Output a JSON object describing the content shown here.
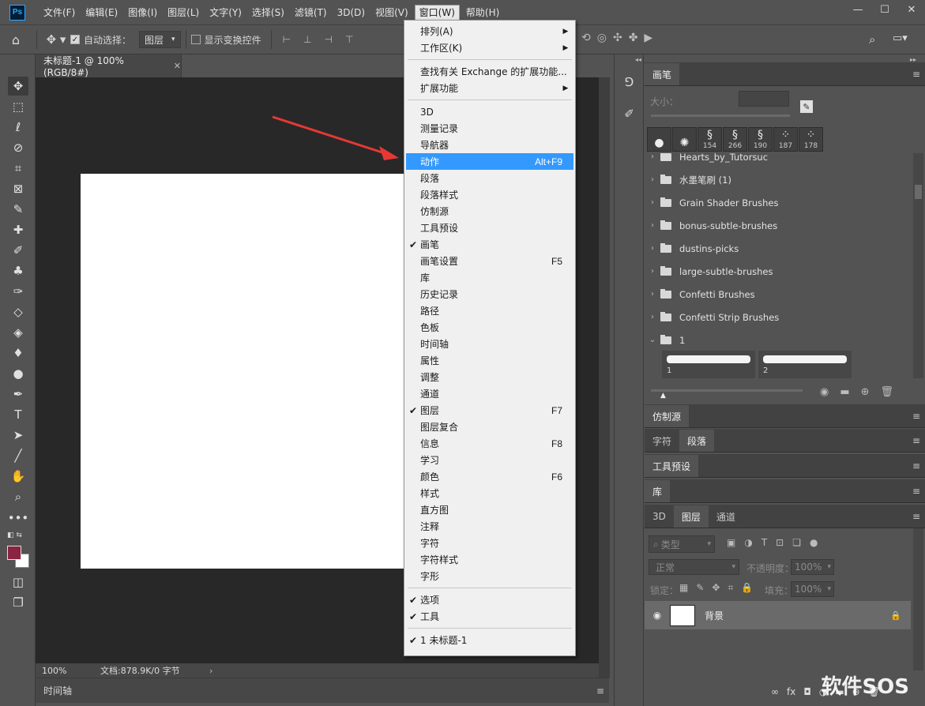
{
  "app": {
    "logo": "Ps"
  },
  "menubar": [
    "文件(F)",
    "编辑(E)",
    "图像(I)",
    "图层(L)",
    "文字(Y)",
    "选择(S)",
    "滤镜(T)",
    "3D(D)",
    "视图(V)",
    "窗口(W)",
    "帮助(H)"
  ],
  "options": {
    "auto_select": "自动选择：",
    "layer_dropdown": "图层",
    "show_transform": "显示变换控件"
  },
  "document": {
    "tab_title": "未标题-1 @ 100%(RGB/8#)",
    "zoom": "100%",
    "doc_info": "文档:878.9K/0 字节"
  },
  "timeline": {
    "label": "时间轴"
  },
  "colors": {
    "foreground": "#8b2342",
    "background": "#ffffff",
    "highlight": "#3399ff",
    "arrow": "#e53935"
  },
  "window_menu": {
    "items": [
      {
        "label": "排列(A)",
        "submenu": true
      },
      {
        "label": "工作区(K)",
        "submenu": true
      },
      {
        "sep": true
      },
      {
        "label": "查找有关 Exchange 的扩展功能..."
      },
      {
        "label": "扩展功能",
        "submenu": true
      },
      {
        "sep": true
      },
      {
        "label": "3D"
      },
      {
        "label": "测量记录"
      },
      {
        "label": "导航器"
      },
      {
        "label": "动作",
        "shortcut": "Alt+F9",
        "highlight": true
      },
      {
        "label": "段落"
      },
      {
        "label": "段落样式"
      },
      {
        "label": "仿制源"
      },
      {
        "label": "工具预设"
      },
      {
        "label": "画笔",
        "checked": true
      },
      {
        "label": "画笔设置",
        "shortcut": "F5"
      },
      {
        "label": "库"
      },
      {
        "label": "历史记录"
      },
      {
        "label": "路径"
      },
      {
        "label": "色板"
      },
      {
        "label": "时间轴"
      },
      {
        "label": "属性"
      },
      {
        "label": "调整"
      },
      {
        "label": "通道"
      },
      {
        "label": "图层",
        "shortcut": "F7",
        "checked": true
      },
      {
        "label": "图层复合"
      },
      {
        "label": "信息",
        "shortcut": "F8"
      },
      {
        "label": "学习"
      },
      {
        "label": "颜色",
        "shortcut": "F6"
      },
      {
        "label": "样式"
      },
      {
        "label": "直方图"
      },
      {
        "label": "注释"
      },
      {
        "label": "字符"
      },
      {
        "label": "字符样式"
      },
      {
        "label": "字形"
      },
      {
        "sep": true
      },
      {
        "label": "选项",
        "checked": true
      },
      {
        "label": "工具",
        "checked": true
      },
      {
        "sep": true
      },
      {
        "label": "1 未标题-1",
        "checked": true
      }
    ]
  },
  "brush_panel": {
    "tab": "画笔",
    "size_label": "大小：",
    "tips": [
      "",
      "",
      "154",
      "266",
      "190",
      "187",
      "178"
    ],
    "partial_row": "Hearts_by_Tutorsuc",
    "folders": [
      "水墨笔刷 (1)",
      "Grain Shader Brushes",
      "bonus-subtle-brushes",
      "dustins-picks",
      "large-subtle-brushes",
      "Confetti Brushes",
      "Confetti Strip Brushes",
      "1"
    ],
    "strokes": [
      "1",
      "2"
    ]
  },
  "panels": {
    "clone": "仿制源",
    "char": "字符",
    "para": "段落",
    "presets": "工具预设",
    "library": "库",
    "layer_tabs": [
      "3D",
      "图层",
      "通道"
    ],
    "kind": "类型",
    "blend": "正常",
    "opacity_label": "不透明度：",
    "opacity": "100%",
    "lock_label": "锁定：",
    "fill_label": "填充：",
    "fill": "100%",
    "layer_name": "背景"
  },
  "watermark": "软件SOS"
}
